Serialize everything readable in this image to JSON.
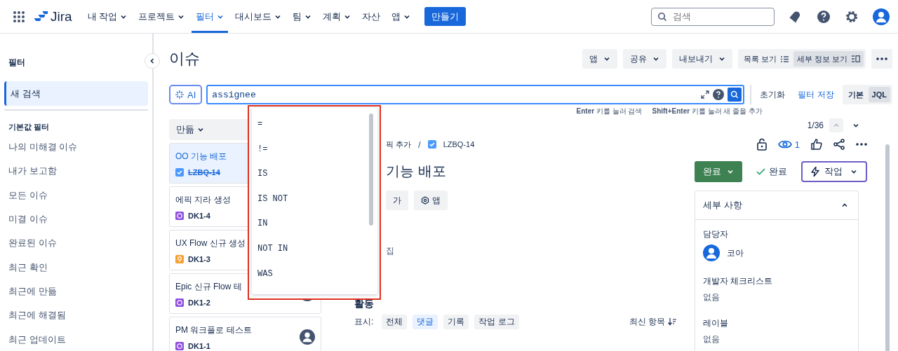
{
  "nav": {
    "logo": "Jira",
    "items": [
      {
        "label": "내 작업",
        "dropdown": true,
        "selected": false
      },
      {
        "label": "프로젝트",
        "dropdown": true,
        "selected": false
      },
      {
        "label": "필터",
        "dropdown": true,
        "selected": true
      },
      {
        "label": "대시보드",
        "dropdown": true,
        "selected": false
      },
      {
        "label": "팀",
        "dropdown": true,
        "selected": false
      },
      {
        "label": "계획",
        "dropdown": true,
        "selected": false
      },
      {
        "label": "자산",
        "dropdown": false,
        "selected": false
      },
      {
        "label": "앱",
        "dropdown": true,
        "selected": false
      }
    ],
    "create": "만들기",
    "search": {
      "placeholder": "검색"
    }
  },
  "sidebar": {
    "title": "필터",
    "items": [
      {
        "label": "새 검색",
        "selected": true
      }
    ],
    "section": "기본값 필터",
    "filters": [
      "나의 미해결 이슈",
      "내가 보고함",
      "모든 이슈",
      "미결 이슈",
      "완료된 이슈",
      "최근 확인",
      "최근에 만듦",
      "최근에 해결됨",
      "최근 업데이트"
    ]
  },
  "page": {
    "title": "이슈",
    "actions": [
      "앱",
      "공유",
      "내보내기"
    ],
    "views": [
      {
        "label": "목록 보기",
        "selected": false,
        "kind": "list"
      },
      {
        "label": "세부 정보 보기",
        "selected": true,
        "kind": "detail"
      }
    ]
  },
  "jql": {
    "ai": "AI",
    "query": "assignee",
    "hints": [
      "**Enter** 키를 눌러 검색",
      "**Shift+Enter** 키를 눌러 새 줄을 추가"
    ],
    "reset": "초기화",
    "save": "필터 저장",
    "modes": [
      {
        "label": "기본",
        "selected": false
      },
      {
        "label": "JQL",
        "selected": true
      }
    ]
  },
  "list": {
    "sort": "만듦",
    "issues": [
      {
        "summary": "OO 기능 배포",
        "key": "LZBQ-14",
        "kind": "task",
        "selected": true,
        "done": true
      },
      {
        "summary": "에픽 지라 생성",
        "key": "DK1-4",
        "kind": "epic",
        "selected": false,
        "done": false
      },
      {
        "summary": "UX Flow 신규 생성",
        "key": "DK1-3",
        "kind": "idea",
        "selected": false,
        "done": false
      },
      {
        "summary": "Epic 신규 Flow 테",
        "key": "DK1-2",
        "kind": "epic",
        "selected": false,
        "done": false,
        "avatar": true
      },
      {
        "summary": "PM 워크플로 테스트",
        "key": "DK1-1",
        "kind": "epic",
        "selected": false,
        "done": false,
        "avatar": true
      }
    ]
  },
  "dropdown": {
    "options": [
      "=",
      "!=",
      "IS",
      "IS NOT",
      "IN",
      "NOT IN",
      "WAS"
    ]
  },
  "detail": {
    "pager": "1/36",
    "parent": "픽 추가",
    "separator": "/",
    "key": "LZBQ-14",
    "watchers": "1",
    "title": "기능 배포",
    "buttons": [
      "가",
      "앱"
    ],
    "edit": "집",
    "status": "완료",
    "resolution": "완료",
    "action": "작업",
    "panel": {
      "title": "세부 사항",
      "fields": [
        {
          "label": "담당자",
          "value": "코아",
          "kind": "person"
        },
        {
          "label": "개발자 체크리스트",
          "value": "없음",
          "kind": "text"
        },
        {
          "label": "레이블",
          "value": "없음",
          "kind": "text"
        }
      ]
    },
    "activity": {
      "title": "활동",
      "show": "표시:",
      "filters": [
        {
          "label": "전체",
          "selected": false
        },
        {
          "label": "댓글",
          "selected": true
        },
        {
          "label": "기록",
          "selected": false
        },
        {
          "label": "작업 로그",
          "selected": false
        }
      ],
      "sort": "최신 항목"
    }
  }
}
